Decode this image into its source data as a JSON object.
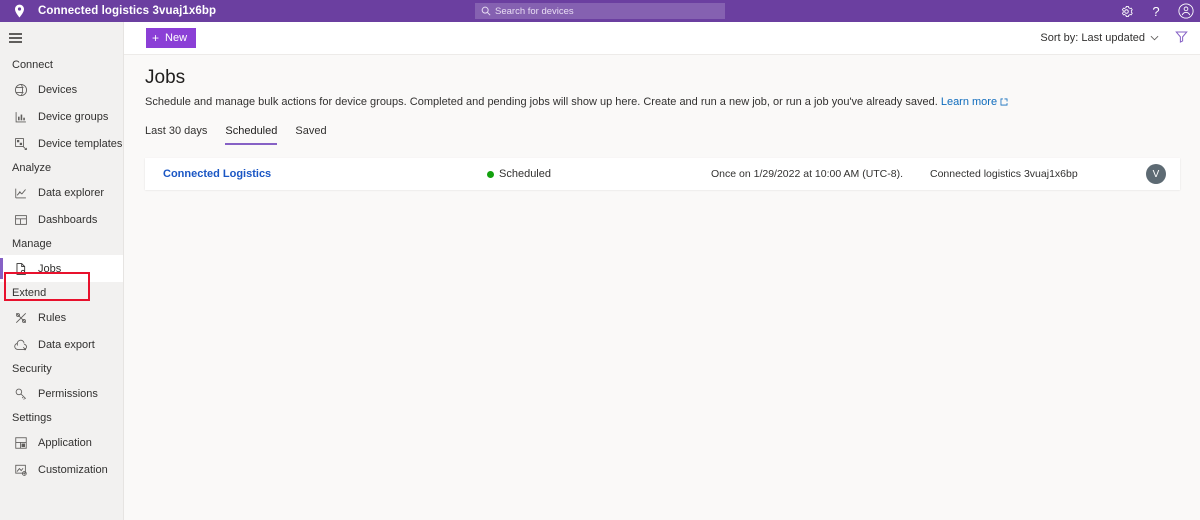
{
  "appbar": {
    "logo_icon": "location-pin-icon",
    "title": "Connected logistics 3vuaj1x6bp",
    "search": {
      "placeholder": "Search for devices",
      "value": "",
      "icon": "search-icon"
    },
    "icons": [
      {
        "name": "gear-icon",
        "glyph": "settings"
      },
      {
        "name": "help-icon",
        "glyph": "?"
      },
      {
        "name": "account-avatar-icon",
        "glyph": "person"
      }
    ],
    "background": "#6b3fa0"
  },
  "sidebar": {
    "menu_icon": "hamburger-icon",
    "groups": [
      {
        "title": "Connect",
        "items": [
          {
            "label": "Devices",
            "icon": "devices-icon",
            "selected": false
          },
          {
            "label": "Device groups",
            "icon": "device-groups-icon",
            "selected": false
          },
          {
            "label": "Device templates",
            "icon": "device-templates-icon",
            "selected": false
          }
        ]
      },
      {
        "title": "Analyze",
        "items": [
          {
            "label": "Data explorer",
            "icon": "data-explorer-icon",
            "selected": false
          },
          {
            "label": "Dashboards",
            "icon": "dashboards-icon",
            "selected": false
          }
        ]
      },
      {
        "title": "Manage",
        "items": [
          {
            "label": "Jobs",
            "icon": "jobs-icon",
            "selected": true
          }
        ]
      },
      {
        "title": "Extend",
        "items": [
          {
            "label": "Rules",
            "icon": "rules-icon",
            "selected": false
          },
          {
            "label": "Data export",
            "icon": "data-export-icon",
            "selected": false
          }
        ]
      },
      {
        "title": "Security",
        "items": [
          {
            "label": "Permissions",
            "icon": "permissions-key-icon",
            "selected": false
          }
        ]
      },
      {
        "title": "Settings",
        "items": [
          {
            "label": "Application",
            "icon": "application-icon",
            "selected": false
          },
          {
            "label": "Customization",
            "icon": "customization-icon",
            "selected": false
          }
        ]
      }
    ]
  },
  "commandbar": {
    "new_label": "New",
    "new_icon": "plus-icon",
    "sort_label": "Sort by: Last updated",
    "sort_chevron_icon": "chevron-down-icon",
    "filter_icon": "filter-funnel-icon",
    "accent": "#8b3fd6"
  },
  "main": {
    "title": "Jobs",
    "description": "Schedule and manage bulk actions for device groups. Completed and pending jobs will show up here. Create and run a new job, or run a job you've already saved.",
    "learn_more_label": "Learn more",
    "learn_more_icon": "external-link-icon",
    "tabs": [
      {
        "label": "Last 30 days",
        "active": false
      },
      {
        "label": "Scheduled",
        "active": true
      },
      {
        "label": "Saved",
        "active": false
      }
    ],
    "jobs": [
      {
        "name": "Connected Logistics",
        "status": "Scheduled",
        "status_color": "#13a10e",
        "schedule": "Once on 1/29/2022 at 10:00 AM (UTC-8).",
        "target": "Connected logistics 3vuaj1x6bp",
        "avatar_initial": "V"
      }
    ]
  },
  "annotation": {
    "highlight_target": "sidebar-item-jobs",
    "color": "#e8112d"
  }
}
